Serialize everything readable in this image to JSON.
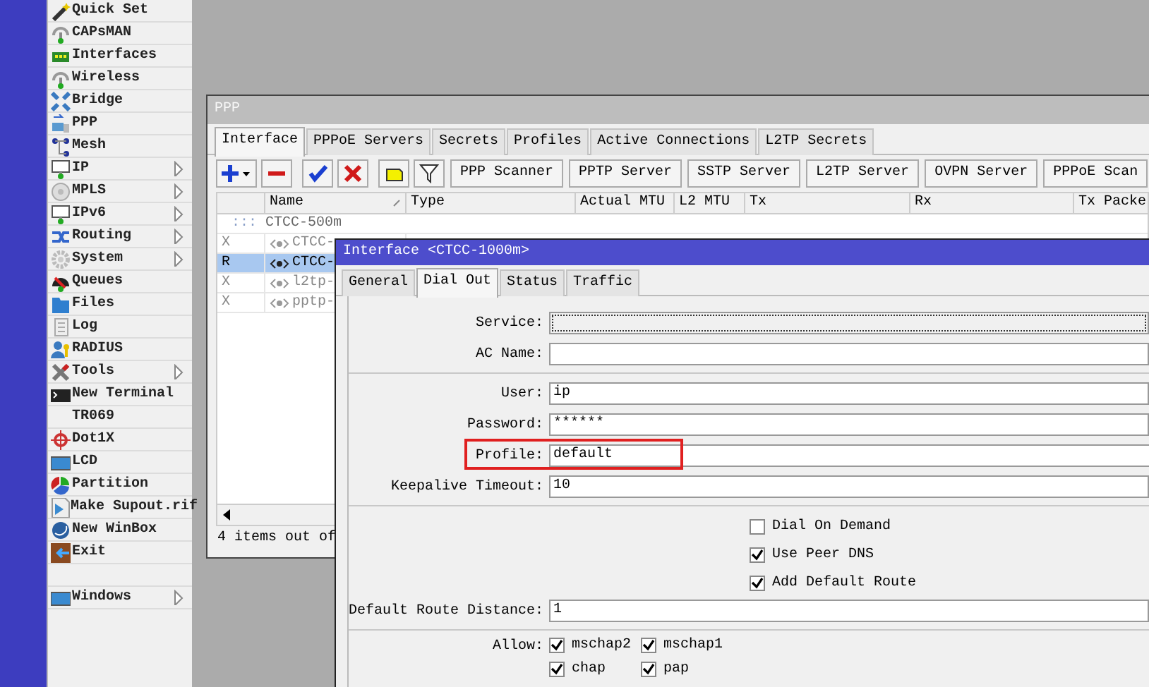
{
  "side_menu": {
    "items": [
      {
        "label": "Quick Set",
        "submenu": false
      },
      {
        "label": "CAPsMAN",
        "submenu": false
      },
      {
        "label": "Interfaces",
        "submenu": false
      },
      {
        "label": "Wireless",
        "submenu": false
      },
      {
        "label": "Bridge",
        "submenu": false
      },
      {
        "label": "PPP",
        "submenu": false
      },
      {
        "label": "Mesh",
        "submenu": false
      },
      {
        "label": "IP",
        "submenu": true
      },
      {
        "label": "MPLS",
        "submenu": true
      },
      {
        "label": "IPv6",
        "submenu": true
      },
      {
        "label": "Routing",
        "submenu": true
      },
      {
        "label": "System",
        "submenu": true
      },
      {
        "label": "Queues",
        "submenu": false
      },
      {
        "label": "Files",
        "submenu": false
      },
      {
        "label": "Log",
        "submenu": false
      },
      {
        "label": "RADIUS",
        "submenu": false
      },
      {
        "label": "Tools",
        "submenu": true
      },
      {
        "label": "New Terminal",
        "submenu": false
      },
      {
        "label": "TR069",
        "submenu": false
      },
      {
        "label": "Dot1X",
        "submenu": false
      },
      {
        "label": "LCD",
        "submenu": false
      },
      {
        "label": "Partition",
        "submenu": false
      },
      {
        "label": "Make Supout.rif",
        "submenu": false
      },
      {
        "label": "New WinBox",
        "submenu": false
      },
      {
        "label": "Exit",
        "submenu": false
      }
    ],
    "bottom_items": [
      {
        "label": "Windows",
        "submenu": true
      }
    ]
  },
  "ppp_window": {
    "title": "PPP",
    "tabs": [
      {
        "label": "Interface",
        "selected": true
      },
      {
        "label": "PPPoE Servers",
        "selected": false
      },
      {
        "label": "Secrets",
        "selected": false
      },
      {
        "label": "Profiles",
        "selected": false
      },
      {
        "label": "Active Connections",
        "selected": false
      },
      {
        "label": "L2TP Secrets",
        "selected": false
      }
    ],
    "toolbar_buttons": [
      "PPP Scanner",
      "PPTP Server",
      "SSTP Server",
      "L2TP Server",
      "OVPN Server",
      "PPPoE Scan"
    ],
    "table": {
      "columns": [
        "",
        "Name",
        "Type",
        "Actual MTU",
        "L2 MTU",
        "Tx",
        "Rx",
        "Tx Packe"
      ],
      "rows": [
        {
          "kind": "comment",
          "marker": ":::",
          "text": "CTCC-500m"
        },
        {
          "kind": "interface",
          "flag": "X",
          "name": "CTCC-",
          "disabled": true,
          "selected": false
        },
        {
          "kind": "interface",
          "flag": "R",
          "name": "CTCC-",
          "disabled": false,
          "selected": true
        },
        {
          "kind": "interface",
          "flag": "X",
          "name": "l2tp-",
          "disabled": true,
          "selected": false
        },
        {
          "kind": "interface",
          "flag": "X",
          "name": "pptp-",
          "disabled": true,
          "selected": false
        }
      ]
    },
    "status": "4 items out of"
  },
  "dialog": {
    "title": "Interface <CTCC-1000m>",
    "tabs": [
      {
        "label": "General",
        "selected": false
      },
      {
        "label": "Dial Out",
        "selected": true
      },
      {
        "label": "Status",
        "selected": false
      },
      {
        "label": "Traffic",
        "selected": false
      }
    ],
    "rows": [
      {
        "kind": "field",
        "label": "Service:",
        "value": "",
        "focused": true,
        "highlighted": false
      },
      {
        "kind": "field",
        "label": "AC Name:",
        "value": "",
        "focused": false,
        "highlighted": false
      },
      {
        "kind": "divider"
      },
      {
        "kind": "field",
        "label": "User:",
        "value": "ip",
        "focused": false,
        "highlighted": false
      },
      {
        "kind": "field",
        "label": "Password:",
        "value": "******",
        "focused": false,
        "highlighted": false
      },
      {
        "kind": "field",
        "label": "Profile:",
        "value": "default",
        "focused": false,
        "highlighted": true
      },
      {
        "kind": "field",
        "label": "Keepalive Timeout:",
        "value": "10",
        "focused": false,
        "highlighted": false
      },
      {
        "kind": "divider"
      },
      {
        "kind": "checkbox",
        "label": "Dial On Demand",
        "checked": false
      },
      {
        "kind": "checkbox",
        "label": "Use Peer DNS",
        "checked": true
      },
      {
        "kind": "checkbox",
        "label": "Add Default Route",
        "checked": true
      },
      {
        "kind": "field",
        "label": "Default Route Distance:",
        "value": "1",
        "focused": false,
        "highlighted": false
      },
      {
        "kind": "divider"
      },
      {
        "kind": "allow",
        "label": "Allow:",
        "options": [
          {
            "label": "mschap2",
            "checked": true
          },
          {
            "label": "mschap1",
            "checked": true
          },
          {
            "label": "chap",
            "checked": true
          },
          {
            "label": "pap",
            "checked": true
          }
        ]
      }
    ]
  }
}
